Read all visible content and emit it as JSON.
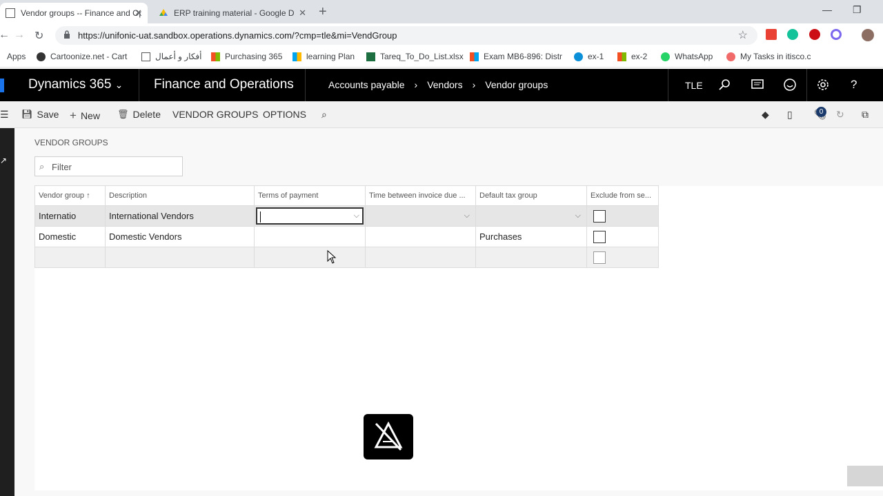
{
  "browser": {
    "tabs": [
      {
        "title": "Vendor groups -- Finance and Op",
        "active": true
      },
      {
        "title": "ERP training material - Google D",
        "active": false
      }
    ],
    "url": "https://unifonic-uat.sandbox.operations.dynamics.com/?cmp=tle&mi=VendGroup",
    "bookmarks": [
      "Apps",
      "Cartoonize.net - Cart",
      "أفكار و أعمال",
      "Purchasing 365",
      "learning Plan",
      "Tareq_To_Do_List.xlsx",
      "Exam MB6-896: Distr",
      "ex-1",
      "ex-2",
      "WhatsApp",
      "My Tasks in itisco.c"
    ]
  },
  "header": {
    "brand": "Dynamics 365",
    "app": "Finance and Operations",
    "breadcrumb": [
      "Accounts payable",
      "Vendors",
      "Vendor groups"
    ],
    "company": "TLE"
  },
  "actions": {
    "save": "Save",
    "new": "New",
    "delete": "Delete",
    "vendor_groups": "VENDOR GROUPS",
    "options": "OPTIONS",
    "notification_count": "0"
  },
  "page": {
    "caption": "VENDOR GROUPS",
    "filter_placeholder": "Filter"
  },
  "grid": {
    "columns": [
      "Vendor group ↑",
      "Description",
      "Terms of payment",
      "Time between invoice due ...",
      "Default tax group",
      "Exclude from se..."
    ],
    "rows": [
      {
        "group": "Internatio",
        "description": "International Vendors",
        "terms": "",
        "time": "",
        "tax": "",
        "exclude": false
      },
      {
        "group": "Domestic",
        "description": "Domestic Vendors",
        "terms": "",
        "time": "",
        "tax": "Purchases",
        "exclude": false
      },
      {
        "group": "",
        "description": "",
        "terms": "",
        "time": "",
        "tax": "",
        "exclude": false
      }
    ]
  },
  "colors": {
    "accent": "#1a73e8",
    "header_bg": "#000000",
    "selected_row": "#e6e6e6"
  }
}
